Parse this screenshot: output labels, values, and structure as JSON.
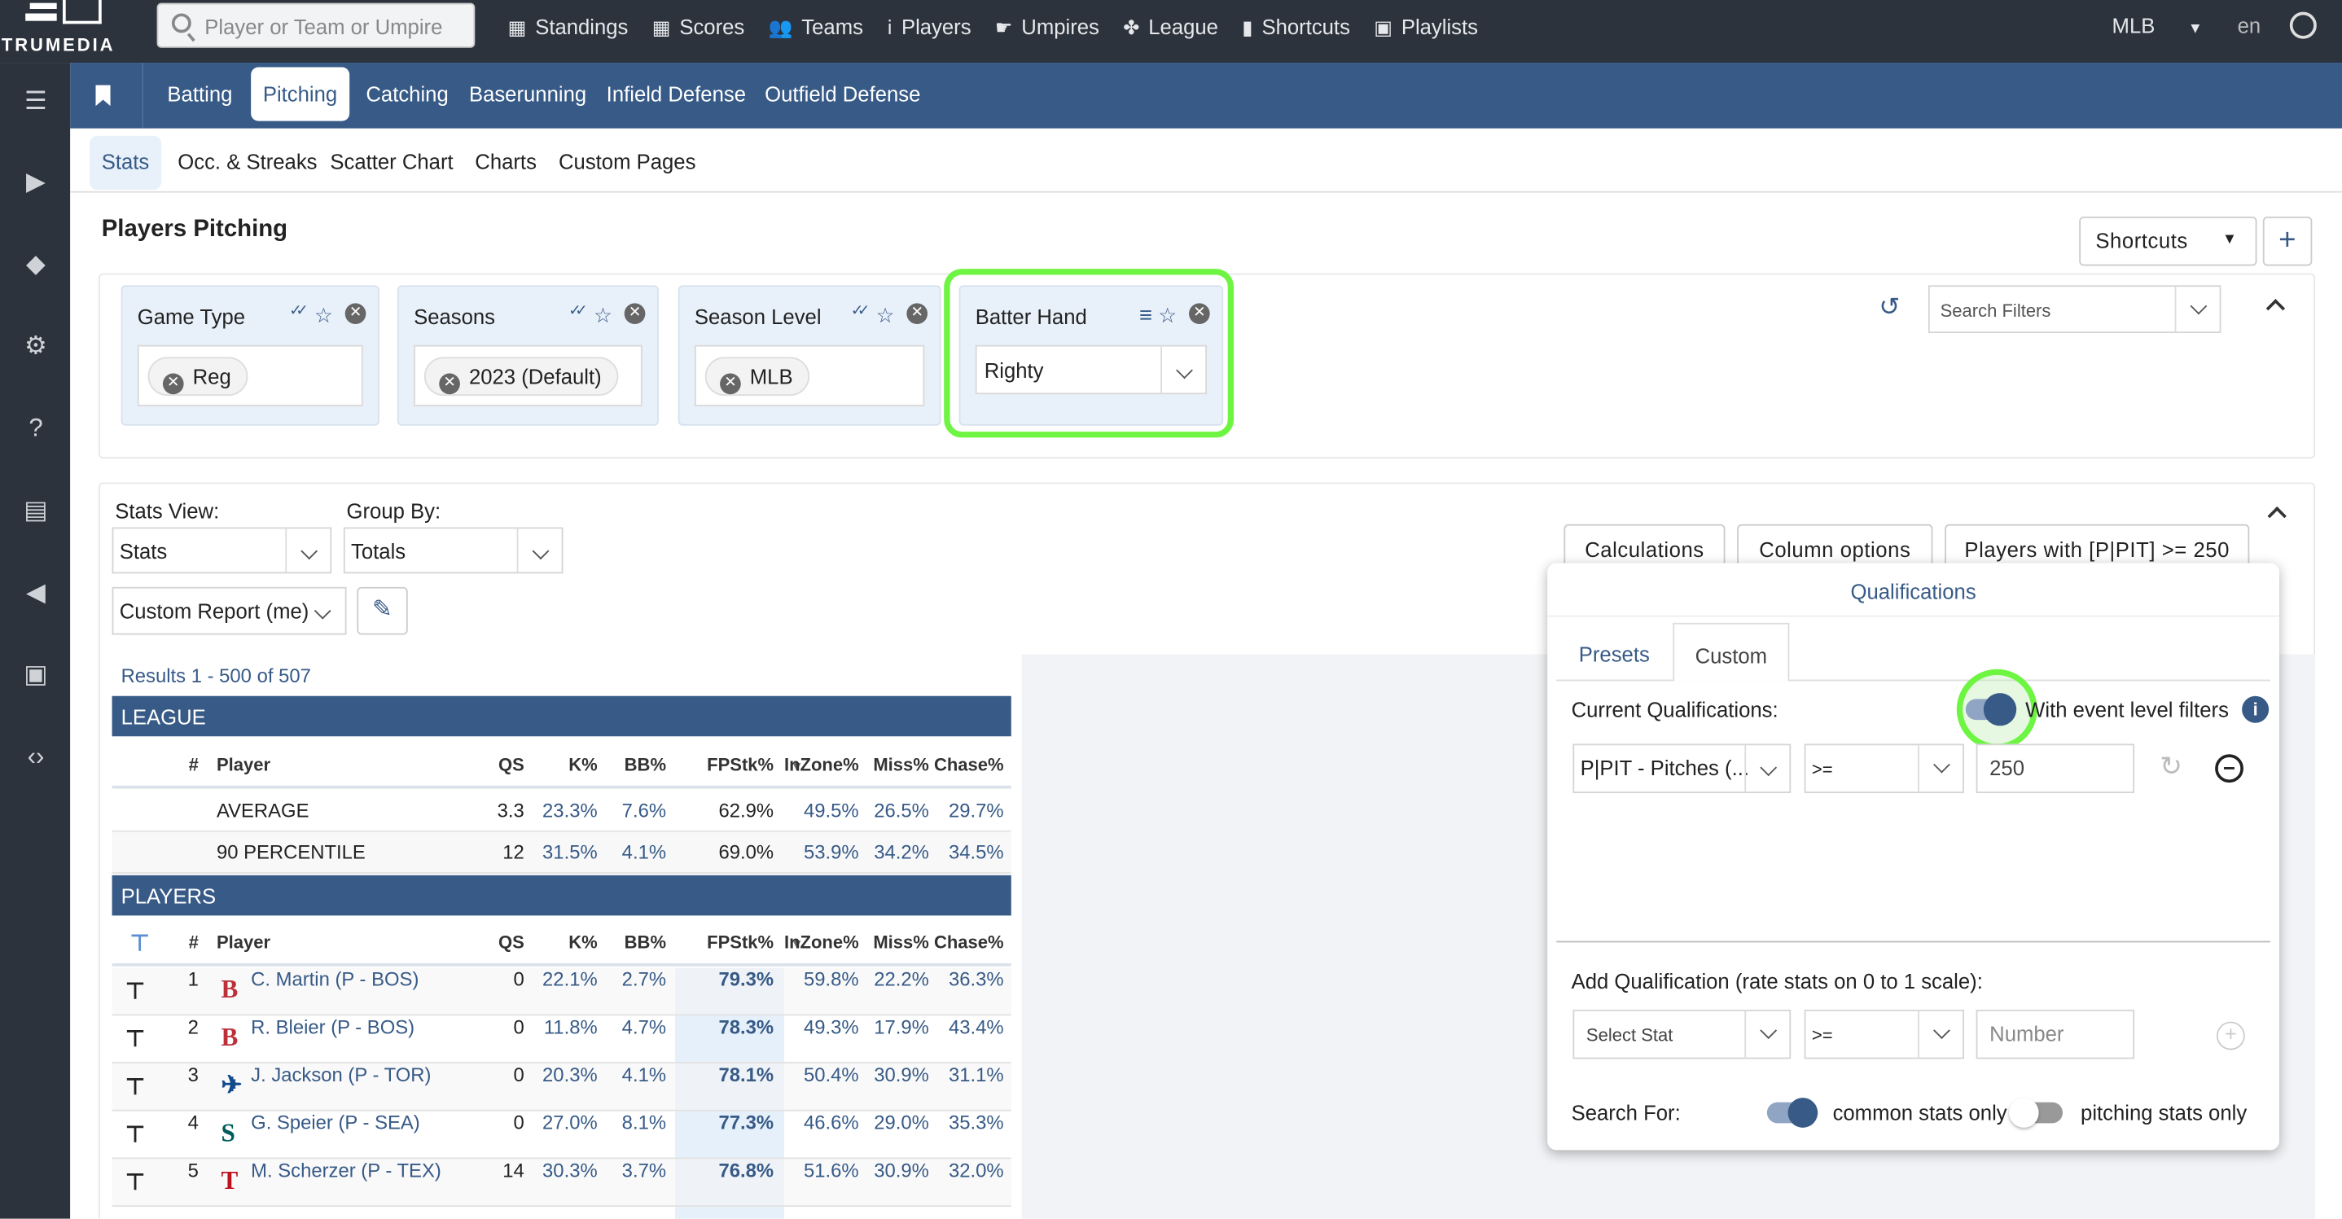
{
  "app": {
    "logo": "TRUMEDIA",
    "search_placeholder": "Player or Team or Umpire",
    "league": "MLB",
    "lang": "en"
  },
  "nav": [
    {
      "label": "Standings",
      "icon": "grid-icon"
    },
    {
      "label": "Scores",
      "icon": "scores-icon"
    },
    {
      "label": "Teams",
      "icon": "users-icon"
    },
    {
      "label": "Players",
      "icon": "person-icon"
    },
    {
      "label": "Umpires",
      "icon": "thumb-icon"
    },
    {
      "label": "League",
      "icon": "league-icon"
    },
    {
      "label": "Shortcuts",
      "icon": "bookmark-icon"
    },
    {
      "label": "Playlists",
      "icon": "playlist-icon"
    }
  ],
  "main_tabs": [
    "Batting",
    "Pitching",
    "Catching",
    "Baserunning",
    "Infield Defense",
    "Outfield Defense"
  ],
  "active_main_tab": "Pitching",
  "sub_tabs": [
    "Stats",
    "Occ. & Streaks",
    "Scatter Chart",
    "Charts",
    "Custom Pages"
  ],
  "page_title": "Players Pitching",
  "shortcuts_label": "Shortcuts",
  "filters": [
    {
      "label": "Game Type",
      "value": "Reg"
    },
    {
      "label": "Seasons",
      "value": "2023 (Default)"
    },
    {
      "label": "Season Level",
      "value": "MLB"
    },
    {
      "label": "Batter Hand",
      "value": "Righty"
    }
  ],
  "search_filters_placeholder": "Search Filters",
  "stats_view": {
    "label": "Stats View:",
    "value": "Stats"
  },
  "group_by": {
    "label": "Group By:",
    "value": "Totals"
  },
  "report": "Custom Report (me)",
  "buttons": {
    "calc": "Calculations",
    "columns": "Column options",
    "players_with": "Players with [P|PIT] >= 250"
  },
  "results": "Results 1 - 500 of 507",
  "table": {
    "league_label": "LEAGUE",
    "players_label": "PLAYERS",
    "columns": [
      "#",
      "Player",
      "QS",
      "K%",
      "BB%",
      "FPStk%",
      "InZone%",
      "Miss%",
      "Chase%"
    ],
    "league_rows": [
      [
        "",
        "AVERAGE",
        "3.3",
        "23.3%",
        "7.6%",
        "62.9%",
        "49.5%",
        "26.5%",
        "29.7%"
      ],
      [
        "",
        "90 PERCENTILE",
        "12",
        "31.5%",
        "4.1%",
        "69.0%",
        "53.9%",
        "34.2%",
        "34.5%"
      ]
    ],
    "players": [
      [
        "1",
        "C. Martin (P - BOS)",
        "0",
        "22.1%",
        "2.7%",
        "79.3%",
        "59.8%",
        "22.2%",
        "36.3%",
        "BOS"
      ],
      [
        "2",
        "R. Bleier (P - BOS)",
        "0",
        "11.8%",
        "4.7%",
        "78.3%",
        "49.3%",
        "17.9%",
        "43.4%",
        "BOS"
      ],
      [
        "3",
        "J. Jackson (P - TOR)",
        "0",
        "20.3%",
        "4.1%",
        "78.1%",
        "50.4%",
        "30.9%",
        "31.1%",
        "TOR"
      ],
      [
        "4",
        "G. Speier (P - SEA)",
        "0",
        "27.0%",
        "8.1%",
        "77.3%",
        "46.6%",
        "29.0%",
        "35.3%",
        "SEA"
      ],
      [
        "5",
        "M. Scherzer (P - TEX)",
        "14",
        "30.3%",
        "3.7%",
        "76.8%",
        "51.6%",
        "30.9%",
        "32.0%",
        "TEX"
      ]
    ]
  },
  "qual": {
    "title": "Qualifications",
    "tabs": [
      "Presets",
      "Custom"
    ],
    "current_label": "Current Qualifications:",
    "event_filters": "With event level filters",
    "stat": "P|PIT - Pitches (...",
    "op": ">=",
    "value": "250",
    "add_label": "Add Qualification (rate stats on 0 to 1 scale):",
    "select_stat": "Select Stat",
    "add_op": ">=",
    "number_placeholder": "Number",
    "search_for": "Search For:",
    "common": "common stats only",
    "pitching": "pitching stats only"
  },
  "colors": {
    "accent": "#375a87",
    "topbar": "#2d333d",
    "highlight": "#6ef542"
  }
}
